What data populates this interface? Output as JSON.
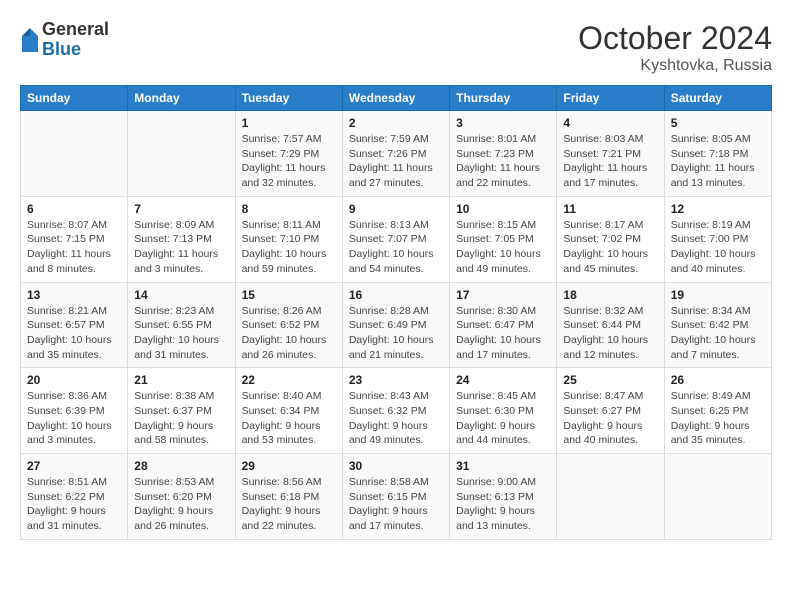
{
  "logo": {
    "general": "General",
    "blue": "Blue"
  },
  "header": {
    "month": "October 2024",
    "location": "Kyshtovka, Russia"
  },
  "days_of_week": [
    "Sunday",
    "Monday",
    "Tuesday",
    "Wednesday",
    "Thursday",
    "Friday",
    "Saturday"
  ],
  "weeks": [
    [
      {
        "day": "",
        "info": ""
      },
      {
        "day": "",
        "info": ""
      },
      {
        "day": "1",
        "info": "Sunrise: 7:57 AM\nSunset: 7:29 PM\nDaylight: 11 hours and 32 minutes."
      },
      {
        "day": "2",
        "info": "Sunrise: 7:59 AM\nSunset: 7:26 PM\nDaylight: 11 hours and 27 minutes."
      },
      {
        "day": "3",
        "info": "Sunrise: 8:01 AM\nSunset: 7:23 PM\nDaylight: 11 hours and 22 minutes."
      },
      {
        "day": "4",
        "info": "Sunrise: 8:03 AM\nSunset: 7:21 PM\nDaylight: 11 hours and 17 minutes."
      },
      {
        "day": "5",
        "info": "Sunrise: 8:05 AM\nSunset: 7:18 PM\nDaylight: 11 hours and 13 minutes."
      }
    ],
    [
      {
        "day": "6",
        "info": "Sunrise: 8:07 AM\nSunset: 7:15 PM\nDaylight: 11 hours and 8 minutes."
      },
      {
        "day": "7",
        "info": "Sunrise: 8:09 AM\nSunset: 7:13 PM\nDaylight: 11 hours and 3 minutes."
      },
      {
        "day": "8",
        "info": "Sunrise: 8:11 AM\nSunset: 7:10 PM\nDaylight: 10 hours and 59 minutes."
      },
      {
        "day": "9",
        "info": "Sunrise: 8:13 AM\nSunset: 7:07 PM\nDaylight: 10 hours and 54 minutes."
      },
      {
        "day": "10",
        "info": "Sunrise: 8:15 AM\nSunset: 7:05 PM\nDaylight: 10 hours and 49 minutes."
      },
      {
        "day": "11",
        "info": "Sunrise: 8:17 AM\nSunset: 7:02 PM\nDaylight: 10 hours and 45 minutes."
      },
      {
        "day": "12",
        "info": "Sunrise: 8:19 AM\nSunset: 7:00 PM\nDaylight: 10 hours and 40 minutes."
      }
    ],
    [
      {
        "day": "13",
        "info": "Sunrise: 8:21 AM\nSunset: 6:57 PM\nDaylight: 10 hours and 35 minutes."
      },
      {
        "day": "14",
        "info": "Sunrise: 8:23 AM\nSunset: 6:55 PM\nDaylight: 10 hours and 31 minutes."
      },
      {
        "day": "15",
        "info": "Sunrise: 8:26 AM\nSunset: 6:52 PM\nDaylight: 10 hours and 26 minutes."
      },
      {
        "day": "16",
        "info": "Sunrise: 8:28 AM\nSunset: 6:49 PM\nDaylight: 10 hours and 21 minutes."
      },
      {
        "day": "17",
        "info": "Sunrise: 8:30 AM\nSunset: 6:47 PM\nDaylight: 10 hours and 17 minutes."
      },
      {
        "day": "18",
        "info": "Sunrise: 8:32 AM\nSunset: 6:44 PM\nDaylight: 10 hours and 12 minutes."
      },
      {
        "day": "19",
        "info": "Sunrise: 8:34 AM\nSunset: 6:42 PM\nDaylight: 10 hours and 7 minutes."
      }
    ],
    [
      {
        "day": "20",
        "info": "Sunrise: 8:36 AM\nSunset: 6:39 PM\nDaylight: 10 hours and 3 minutes."
      },
      {
        "day": "21",
        "info": "Sunrise: 8:38 AM\nSunset: 6:37 PM\nDaylight: 9 hours and 58 minutes."
      },
      {
        "day": "22",
        "info": "Sunrise: 8:40 AM\nSunset: 6:34 PM\nDaylight: 9 hours and 53 minutes."
      },
      {
        "day": "23",
        "info": "Sunrise: 8:43 AM\nSunset: 6:32 PM\nDaylight: 9 hours and 49 minutes."
      },
      {
        "day": "24",
        "info": "Sunrise: 8:45 AM\nSunset: 6:30 PM\nDaylight: 9 hours and 44 minutes."
      },
      {
        "day": "25",
        "info": "Sunrise: 8:47 AM\nSunset: 6:27 PM\nDaylight: 9 hours and 40 minutes."
      },
      {
        "day": "26",
        "info": "Sunrise: 8:49 AM\nSunset: 6:25 PM\nDaylight: 9 hours and 35 minutes."
      }
    ],
    [
      {
        "day": "27",
        "info": "Sunrise: 8:51 AM\nSunset: 6:22 PM\nDaylight: 9 hours and 31 minutes."
      },
      {
        "day": "28",
        "info": "Sunrise: 8:53 AM\nSunset: 6:20 PM\nDaylight: 9 hours and 26 minutes."
      },
      {
        "day": "29",
        "info": "Sunrise: 8:56 AM\nSunset: 6:18 PM\nDaylight: 9 hours and 22 minutes."
      },
      {
        "day": "30",
        "info": "Sunrise: 8:58 AM\nSunset: 6:15 PM\nDaylight: 9 hours and 17 minutes."
      },
      {
        "day": "31",
        "info": "Sunrise: 9:00 AM\nSunset: 6:13 PM\nDaylight: 9 hours and 13 minutes."
      },
      {
        "day": "",
        "info": ""
      },
      {
        "day": "",
        "info": ""
      }
    ]
  ]
}
